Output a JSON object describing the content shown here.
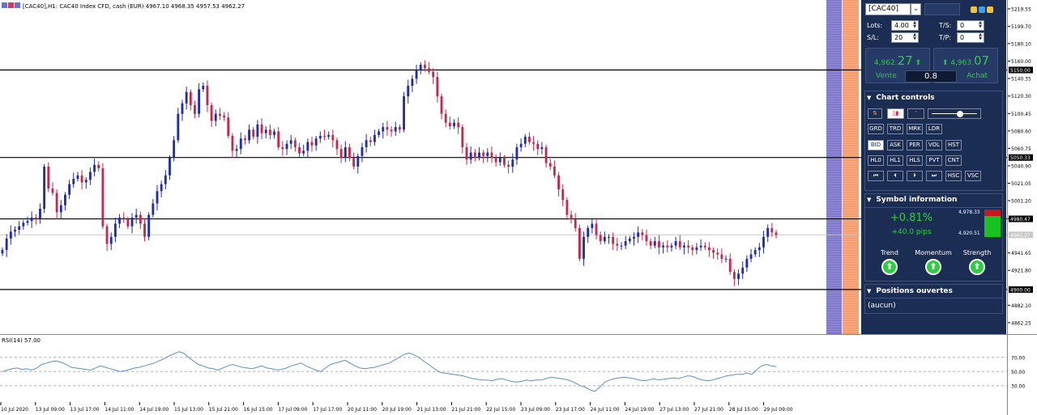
{
  "chart_header": {
    "symbol_text": "[CAC40],H1:  CAC40 Index CFD, cash (EUR)  4967.10 4968.35 4957.53 4962.27"
  },
  "chart_data": {
    "type": "candlestick",
    "title": "[CAC40],H1:  CAC40 Index CFD, cash (EUR)  4967.10 4968.35 4957.53 4962.27",
    "ylim": [
      4852,
      5226
    ],
    "y_ticks": [
      "5219.55",
      "5199.70",
      "5180.10",
      "5160.00",
      "5140.35",
      "5120.30",
      "5100.45",
      "5080.60",
      "5060.75",
      "5040.90",
      "5021.05",
      "5001.20",
      "4980.47",
      "4941.65",
      "4921.80",
      "4882.10",
      "4862.25"
    ],
    "right_axis_boxes": [
      "5150.00",
      "5050.33",
      "4980.47",
      "4962.27",
      "4900.00"
    ],
    "x_labels": [
      "10 Jul 2020",
      "13 Jul 09:00",
      "13 Jul 17:00",
      "14 Jul 11:00",
      "14 Jul 19:00",
      "15 Jul 13:00",
      "15 Jul 21:00",
      "16 Jul 15:00",
      "17 Jul 09:00",
      "17 Jul 17:00",
      "20 Jul 11:00",
      "20 Jul 19:00",
      "21 Jul 13:00",
      "21 Jul 21:00",
      "22 Jul 15:00",
      "23 Jul 09:00",
      "23 Jul 17:00",
      "24 Jul 11:00",
      "24 Jul 19:00",
      "27 Jul 13:00",
      "27 Jul 21:00",
      "28 Jul 15:00",
      "29 Jul 09:00"
    ],
    "horizontal_levels": [
      5150.0,
      5050.33,
      4980.47,
      4900.0
    ],
    "close_series": [
      4945,
      4958,
      4966,
      4968,
      4972,
      4976,
      4978,
      4982,
      4981,
      4992,
      5040,
      5015,
      5010,
      4988,
      4996,
      5008,
      5020,
      5026,
      5030,
      5022,
      5025,
      5034,
      5042,
      5038,
      4972,
      4952,
      4960,
      4975,
      4982,
      4980,
      4972,
      4982,
      4985,
      4975,
      4960,
      4985,
      4998,
      5012,
      5020,
      5030,
      5050,
      5070,
      5100,
      5112,
      5125,
      5110,
      5100,
      5128,
      5132,
      5110,
      5092,
      5100,
      5098,
      5096,
      5075,
      5058,
      5060,
      5072,
      5070,
      5082,
      5074,
      5088,
      5078,
      5082,
      5076,
      5080,
      5062,
      5060,
      5066,
      5070,
      5062,
      5055,
      5058,
      5068,
      5064,
      5072,
      5075,
      5074,
      5076,
      5070,
      5060,
      5050,
      5062,
      5050,
      5040,
      5052,
      5062,
      5070,
      5068,
      5076,
      5080,
      5085,
      5082,
      5080,
      5085,
      5082,
      5120,
      5132,
      5140,
      5150,
      5156,
      5152,
      5148,
      5142,
      5120,
      5100,
      5090,
      5086,
      5090,
      5085,
      5062,
      5048,
      5056,
      5050,
      5056,
      5052,
      5056,
      5050,
      5045,
      5050,
      5042,
      5040,
      5048,
      5062,
      5066,
      5074,
      5068,
      5066,
      5060,
      5062,
      5044,
      5040,
      5030,
      5014,
      5002,
      4985,
      4980,
      4970,
      4935,
      4960,
      4970,
      4975,
      4962,
      4955,
      4960,
      4960,
      4952,
      4950,
      4950,
      4955,
      4958,
      4960,
      4965,
      4962,
      4955,
      4950,
      4955,
      4948,
      4950,
      4948,
      4950,
      4955,
      4948,
      4950,
      4948,
      4945,
      4948,
      4950,
      4948,
      4945,
      4942,
      4940,
      4935,
      4935,
      4920,
      4912,
      4918,
      4925,
      4935,
      4940,
      4945,
      4948,
      4960,
      4970,
      4965,
      4962
    ],
    "rsi": {
      "label": "RSI(14) 57.00",
      "ylim": [
        0,
        100
      ],
      "y_ticks": [
        "70.00",
        "50.00",
        "30.00"
      ],
      "levels": [
        70,
        50,
        30
      ],
      "values": [
        50,
        52,
        54,
        55,
        53,
        54,
        52,
        55,
        60,
        62,
        64,
        65,
        63,
        60,
        56,
        55,
        54,
        53,
        52,
        55,
        58,
        56,
        54,
        52,
        50,
        51,
        53,
        55,
        56,
        58,
        60,
        62,
        65,
        68,
        72,
        75,
        78,
        76,
        70,
        65,
        60,
        58,
        55,
        54,
        52,
        55,
        58,
        60,
        58,
        56,
        55,
        54,
        56,
        58,
        55,
        54,
        52,
        53,
        55,
        58,
        60,
        62,
        58,
        55,
        52,
        50,
        55,
        60,
        62,
        64,
        66,
        62,
        58,
        55,
        54,
        55,
        56,
        58,
        60,
        62,
        66,
        70,
        74,
        76,
        74,
        70,
        65,
        60,
        55,
        50,
        48,
        47,
        46,
        45,
        44,
        42,
        40,
        39,
        38,
        38,
        37,
        39,
        40,
        38,
        36,
        35,
        36,
        38,
        37,
        38,
        38,
        40,
        42,
        41,
        40,
        39,
        37,
        34,
        30,
        28,
        24,
        22,
        28,
        35,
        38,
        40,
        41,
        42,
        41,
        40,
        38,
        37,
        38,
        40,
        38,
        39,
        40,
        41,
        40,
        42,
        44,
        43,
        40,
        38,
        37,
        38,
        40,
        42,
        44,
        45,
        46,
        46,
        48,
        46,
        52,
        58,
        60,
        58,
        57
      ]
    }
  },
  "panel": {
    "symbol": "[CAC40]",
    "lots_label": "Lots:",
    "lots_value": "4.00",
    "sl_label": "S/L:",
    "sl_value": "20",
    "ts_label": "T/S:",
    "ts_value": "0",
    "tp_label": "T/P:",
    "tp_value": "0",
    "sell_price_small": "4,962.",
    "sell_price_big": "27",
    "sell_label": "Vente",
    "buy_price_small": "4,963.",
    "buy_price_big": "07",
    "buy_label": "Achat",
    "spread": "0.8",
    "chart_controls_title": "Chart controls",
    "btn_row1": [
      "GRD",
      "TRD",
      "MRK",
      "LDR"
    ],
    "btn_row2": [
      "BID",
      "ASK",
      "PER",
      "VOL",
      "HST"
    ],
    "btn_row3": [
      "HL0",
      "HL1",
      "HLS",
      "PVT",
      "CNT"
    ],
    "btn_row4": [
      "⏮",
      "⏴",
      "⏵",
      "⏭",
      "HSC",
      "VSC"
    ],
    "symbol_info_title": "Symbol information",
    "change_pct": "+0.81%",
    "change_pips": "+40.0 pips",
    "range_high": "4,978.33",
    "range_low": "4,920.51",
    "trend_label": "Trend",
    "momentum_label": "Momentum",
    "strength_label": "Strength",
    "positions_title": "Positions ouvertes",
    "positions_value": "(aucun)"
  },
  "colors": {
    "bull": "#1f2ea8",
    "bear": "#c4294d",
    "panel_bg": "#1b2d52",
    "purple_band": "#7b74c9",
    "orange_band": "#f39a6a",
    "green": "#2ecc40"
  }
}
